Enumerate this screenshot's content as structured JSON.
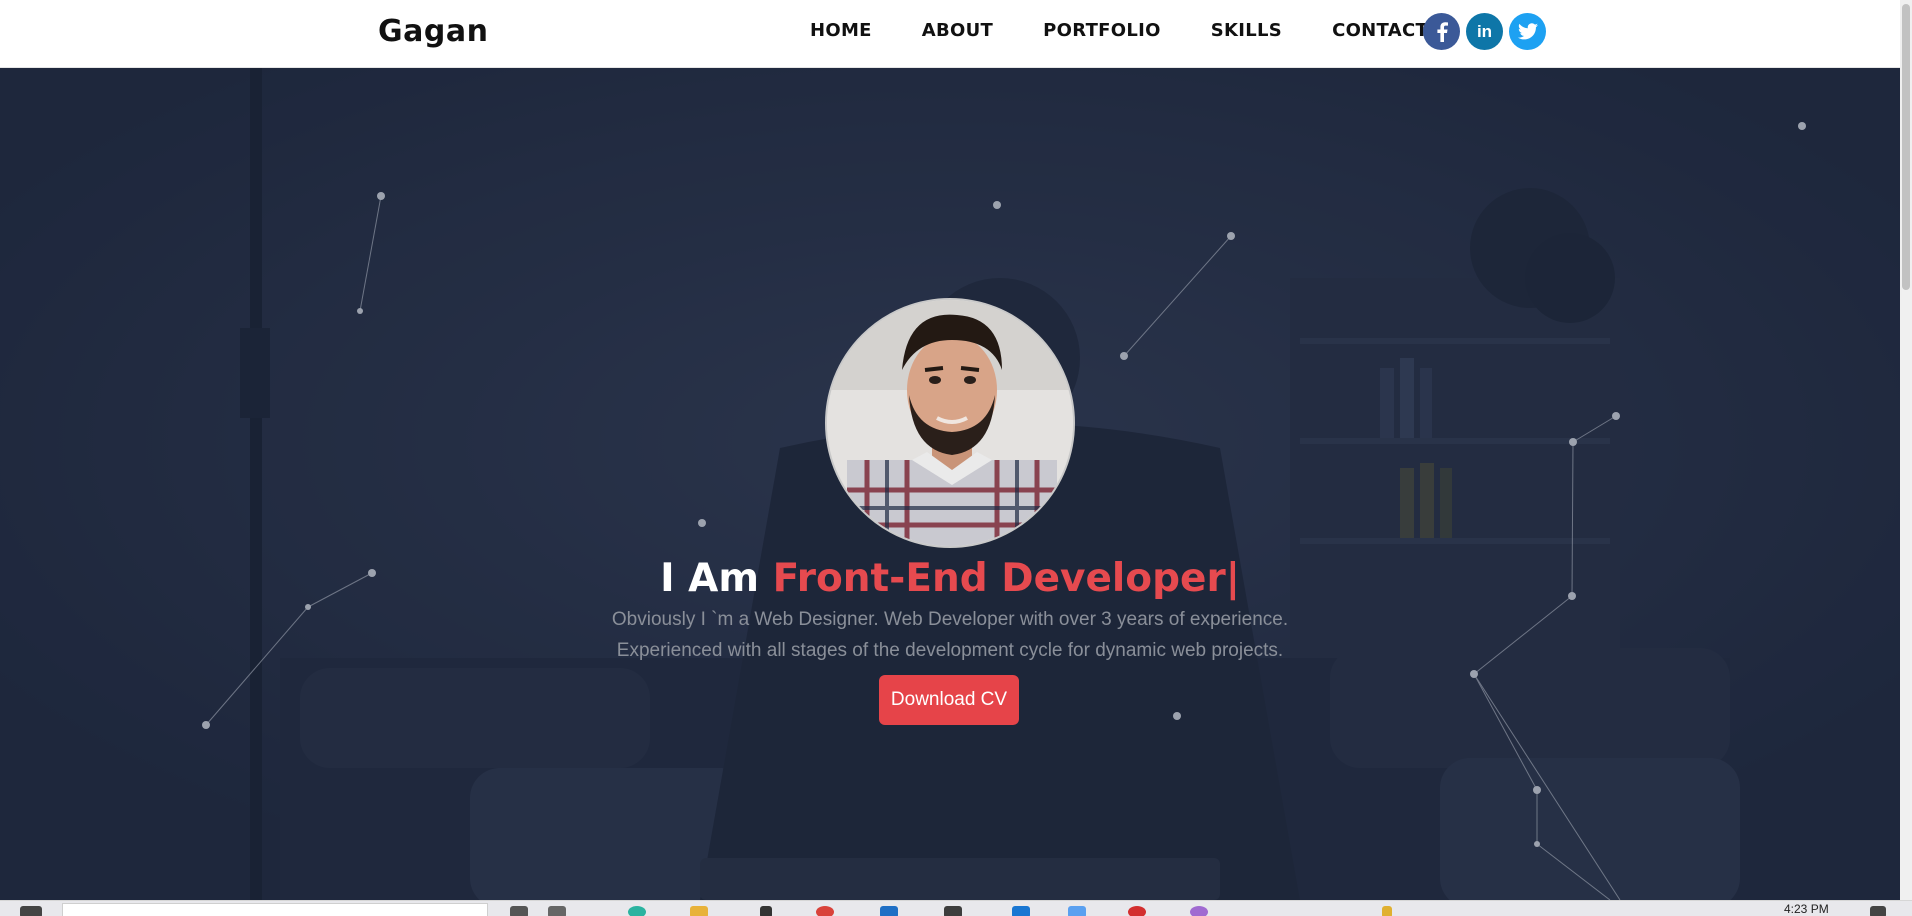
{
  "brand": "Gagan",
  "nav": {
    "items": [
      {
        "label": "HOME"
      },
      {
        "label": "ABOUT"
      },
      {
        "label": "PORTFOLIO"
      },
      {
        "label": "SKILLS"
      },
      {
        "label": "CONTACT"
      }
    ]
  },
  "socials": [
    {
      "icon": "facebook-icon",
      "glyph": "f",
      "color": "#3b5998"
    },
    {
      "icon": "linkedin-icon",
      "glyph": "in",
      "color": "#0e76a8"
    },
    {
      "icon": "twitter-icon",
      "glyph": "🐦",
      "color": "#1da1f2"
    }
  ],
  "hero": {
    "intro": "I Am ",
    "role": "Front-End Developer|",
    "description_line1": "Obviously I `m a Web Designer. Web Developer with over 3 years of experience.",
    "description_line2": "Experienced with all stages of the development cycle for dynamic web projects.",
    "cta_label": "Download CV",
    "accent_color": "#e64449"
  },
  "taskbar": {
    "clock": "4:23 PM"
  }
}
